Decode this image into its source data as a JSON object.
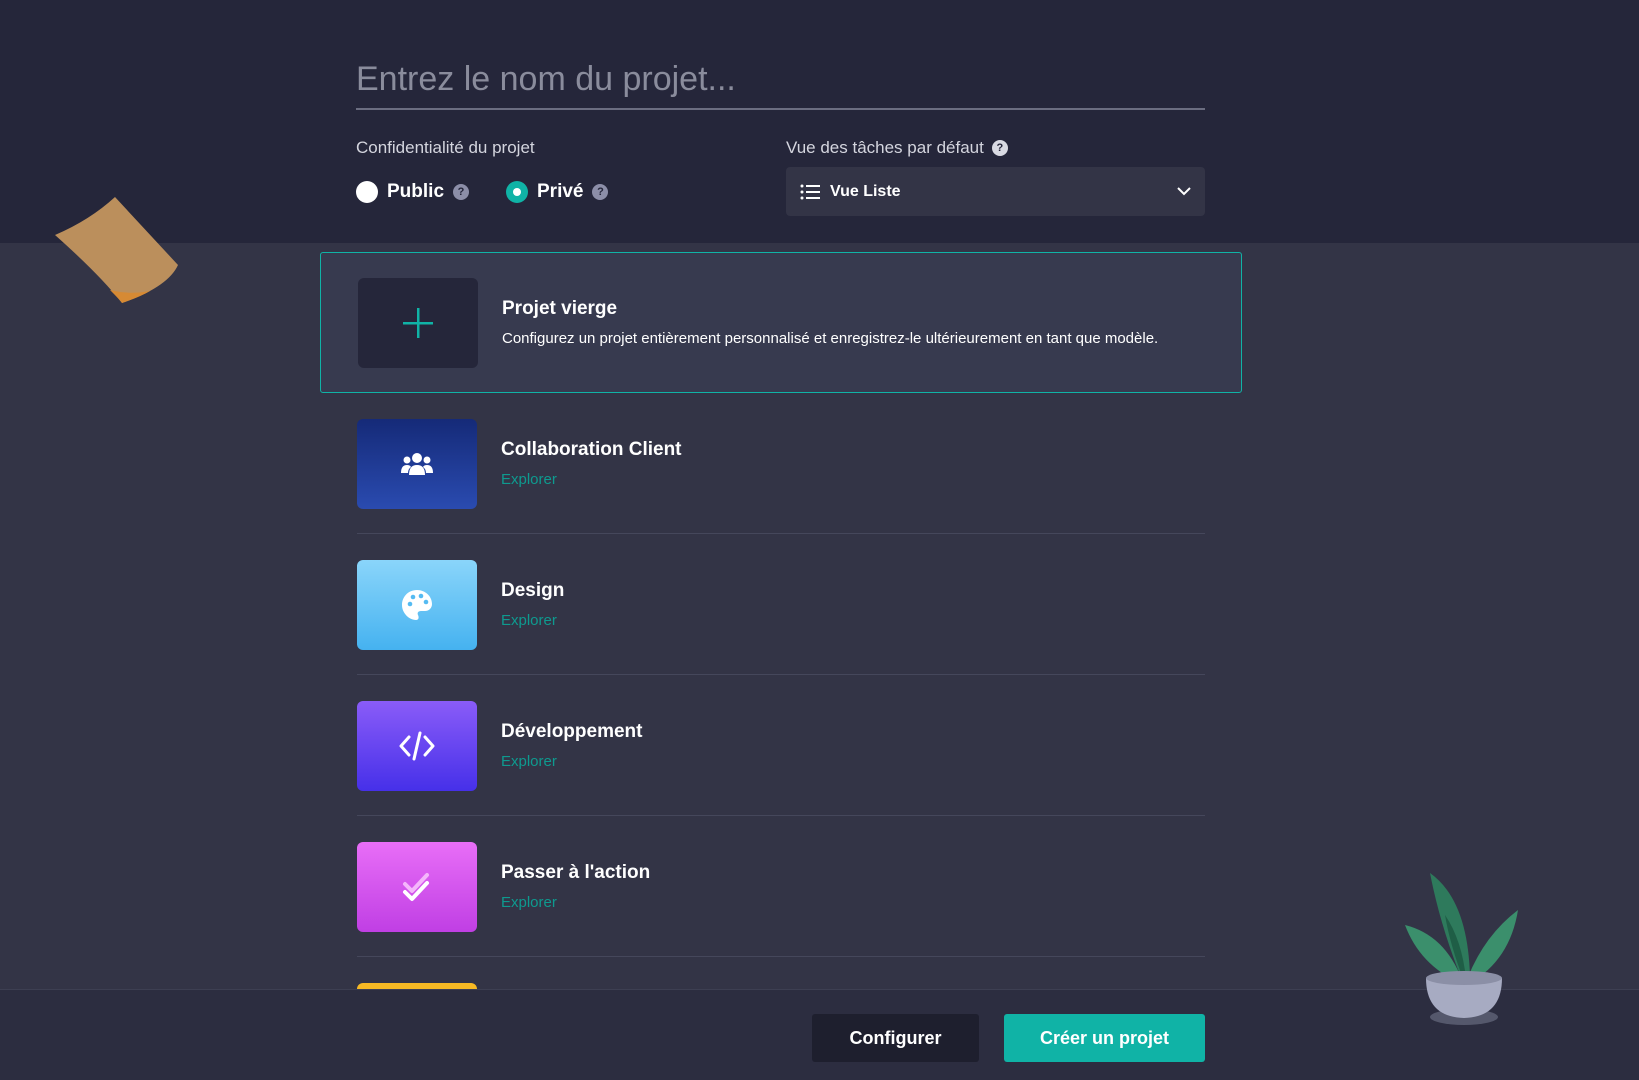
{
  "project_name": {
    "placeholder": "Entrez le nom du projet..."
  },
  "privacy": {
    "label": "Confidentialité du projet",
    "options": [
      {
        "label": "Public",
        "selected": false
      },
      {
        "label": "Privé",
        "selected": true
      }
    ]
  },
  "default_view": {
    "label": "Vue des tâches par défaut",
    "selected": "Vue Liste"
  },
  "templates": [
    {
      "title": "Projet vierge",
      "description": "Configurez un projet entièrement personnalisé et enregistrez-le ultérieurement en tant que modèle.",
      "icon": "plus-icon"
    },
    {
      "title": "Collaboration Client",
      "link": "Explorer",
      "icon": "users-icon"
    },
    {
      "title": "Design",
      "link": "Explorer",
      "icon": "palette-icon"
    },
    {
      "title": "Développement",
      "link": "Explorer",
      "icon": "code-icon"
    },
    {
      "title": "Passer à l'action",
      "link": "Explorer",
      "icon": "double-check-icon"
    }
  ],
  "footer": {
    "configure_label": "Configurer",
    "create_label": "Créer un projet"
  },
  "colors": {
    "accent": "#10b3a6",
    "background": "#333446",
    "header_background": "#25263a"
  }
}
